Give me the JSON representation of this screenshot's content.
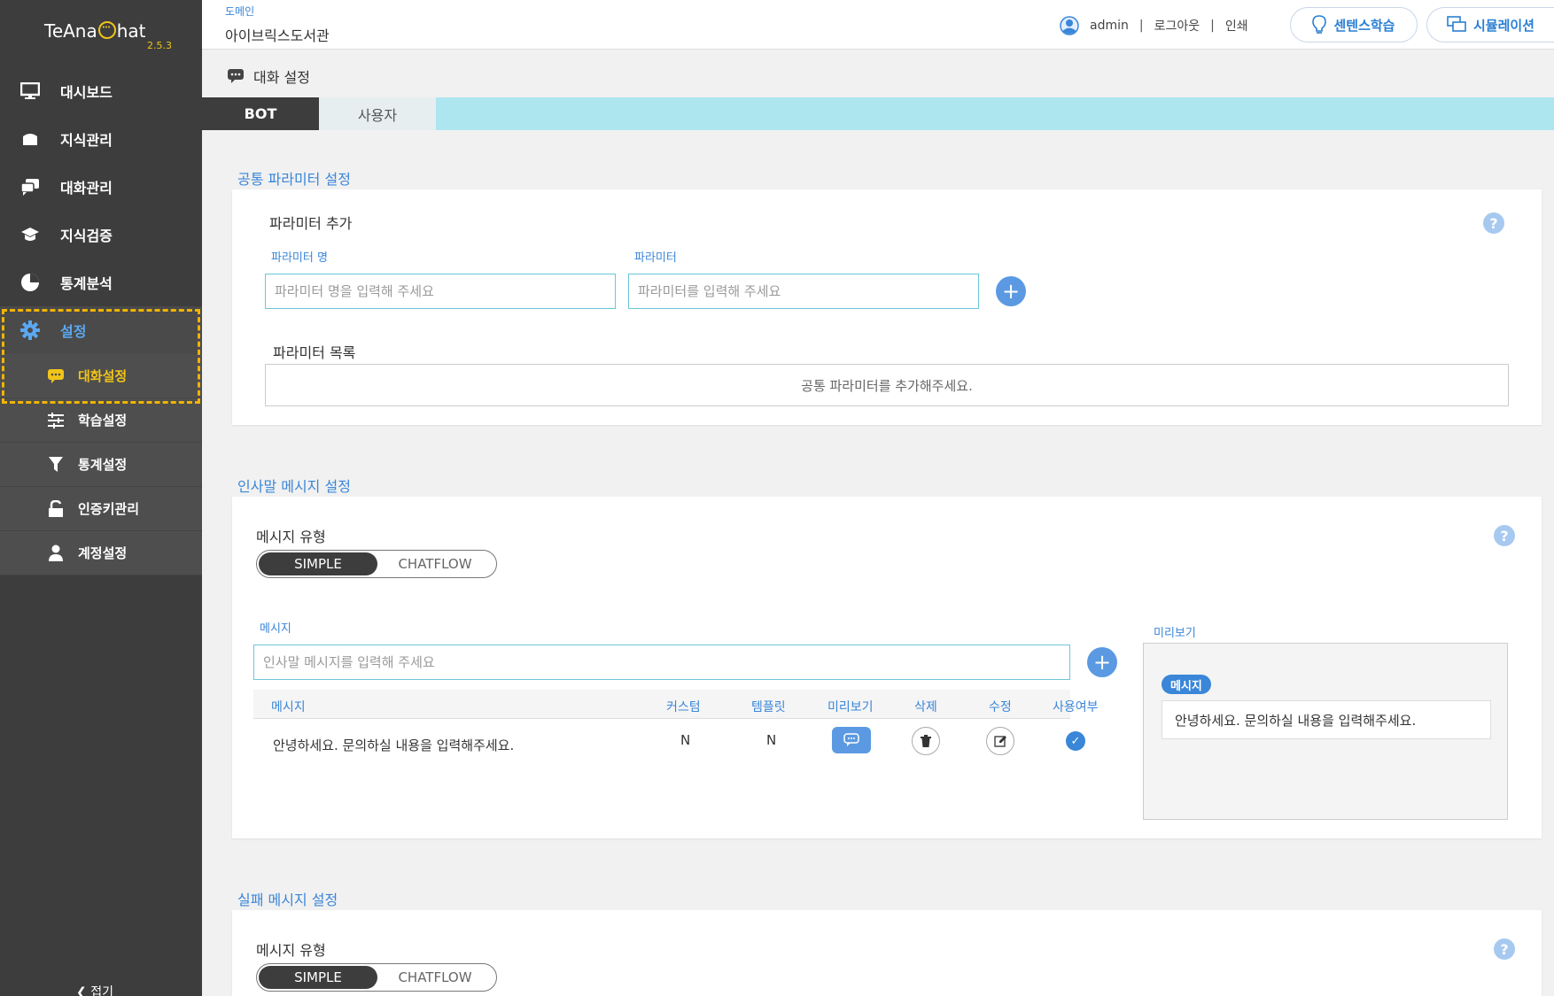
{
  "app": {
    "logo_left": "TeAna",
    "logo_right": "hat",
    "version": "2.5.3"
  },
  "sidebar": {
    "menu": [
      {
        "label": "대시보드",
        "icon": "monitor-icon"
      },
      {
        "label": "지식관리",
        "icon": "box-icon"
      },
      {
        "label": "대화관리",
        "icon": "chat-icon"
      },
      {
        "label": "지식검증",
        "icon": "graduation-cap-icon"
      },
      {
        "label": "통계분석",
        "icon": "pie-chart-icon"
      },
      {
        "label": "설정",
        "icon": "gear-icon",
        "active": true
      }
    ],
    "submenu": [
      {
        "label": "대화설정",
        "icon": "chat-bubble-icon",
        "active": true
      },
      {
        "label": "학습설정",
        "icon": "sliders-icon"
      },
      {
        "label": "통계설정",
        "icon": "funnel-icon"
      },
      {
        "label": "인증키관리",
        "icon": "lock-icon"
      },
      {
        "label": "계정설정",
        "icon": "user-icon"
      }
    ],
    "collapse_label": "접기"
  },
  "header": {
    "domain_label": "도메인",
    "domain_value": "아이브릭스도서관",
    "user": "admin",
    "logout": "로그아웃",
    "print": "인쇄",
    "sentence_learning": "센텐스학습",
    "simulation": "시뮬레이션"
  },
  "page": {
    "title": "대화 설정",
    "tabs": [
      "BOT",
      "사용자"
    ]
  },
  "common_params": {
    "section_title": "공통 파라미터 설정",
    "add_title": "파라미터 추가",
    "name_label": "파라미터 명",
    "name_placeholder": "파라미터 명을 입력해 주세요",
    "param_label": "파라미터",
    "param_placeholder": "파라미터를 입력해 주세요",
    "list_title": "파라미터 목록",
    "empty_text": "공통 파라미터를 추가해주세요."
  },
  "greeting": {
    "section_title": "인사말 메시지 설정",
    "type_label": "메시지 유형",
    "type_options": [
      "SIMPLE",
      "CHATFLOW"
    ],
    "message_label": "메시지",
    "message_placeholder": "인사말 메시지를 입력해 주세요",
    "columns": [
      "메시지",
      "커스텀",
      "템플릿",
      "미리보기",
      "삭제",
      "수정",
      "사용여부"
    ],
    "rows": [
      {
        "message": "안녕하세요. 문의하실 내용을 입력해주세요.",
        "custom": "N",
        "template": "N",
        "enabled": true
      }
    ],
    "preview_label": "미리보기",
    "preview_badge": "메시지",
    "preview_text": "안녕하세요. 문의하실 내용을 입력해주세요."
  },
  "failure": {
    "section_title": "실패 메시지 설정",
    "type_label": "메시지 유형",
    "type_options": [
      "SIMPLE",
      "CHATFLOW"
    ]
  },
  "colors": {
    "accent": "#3a86d8",
    "sidebar": "#3d3d3d",
    "highlight": "#f0c419",
    "tab_bar": "#aee6f0"
  }
}
